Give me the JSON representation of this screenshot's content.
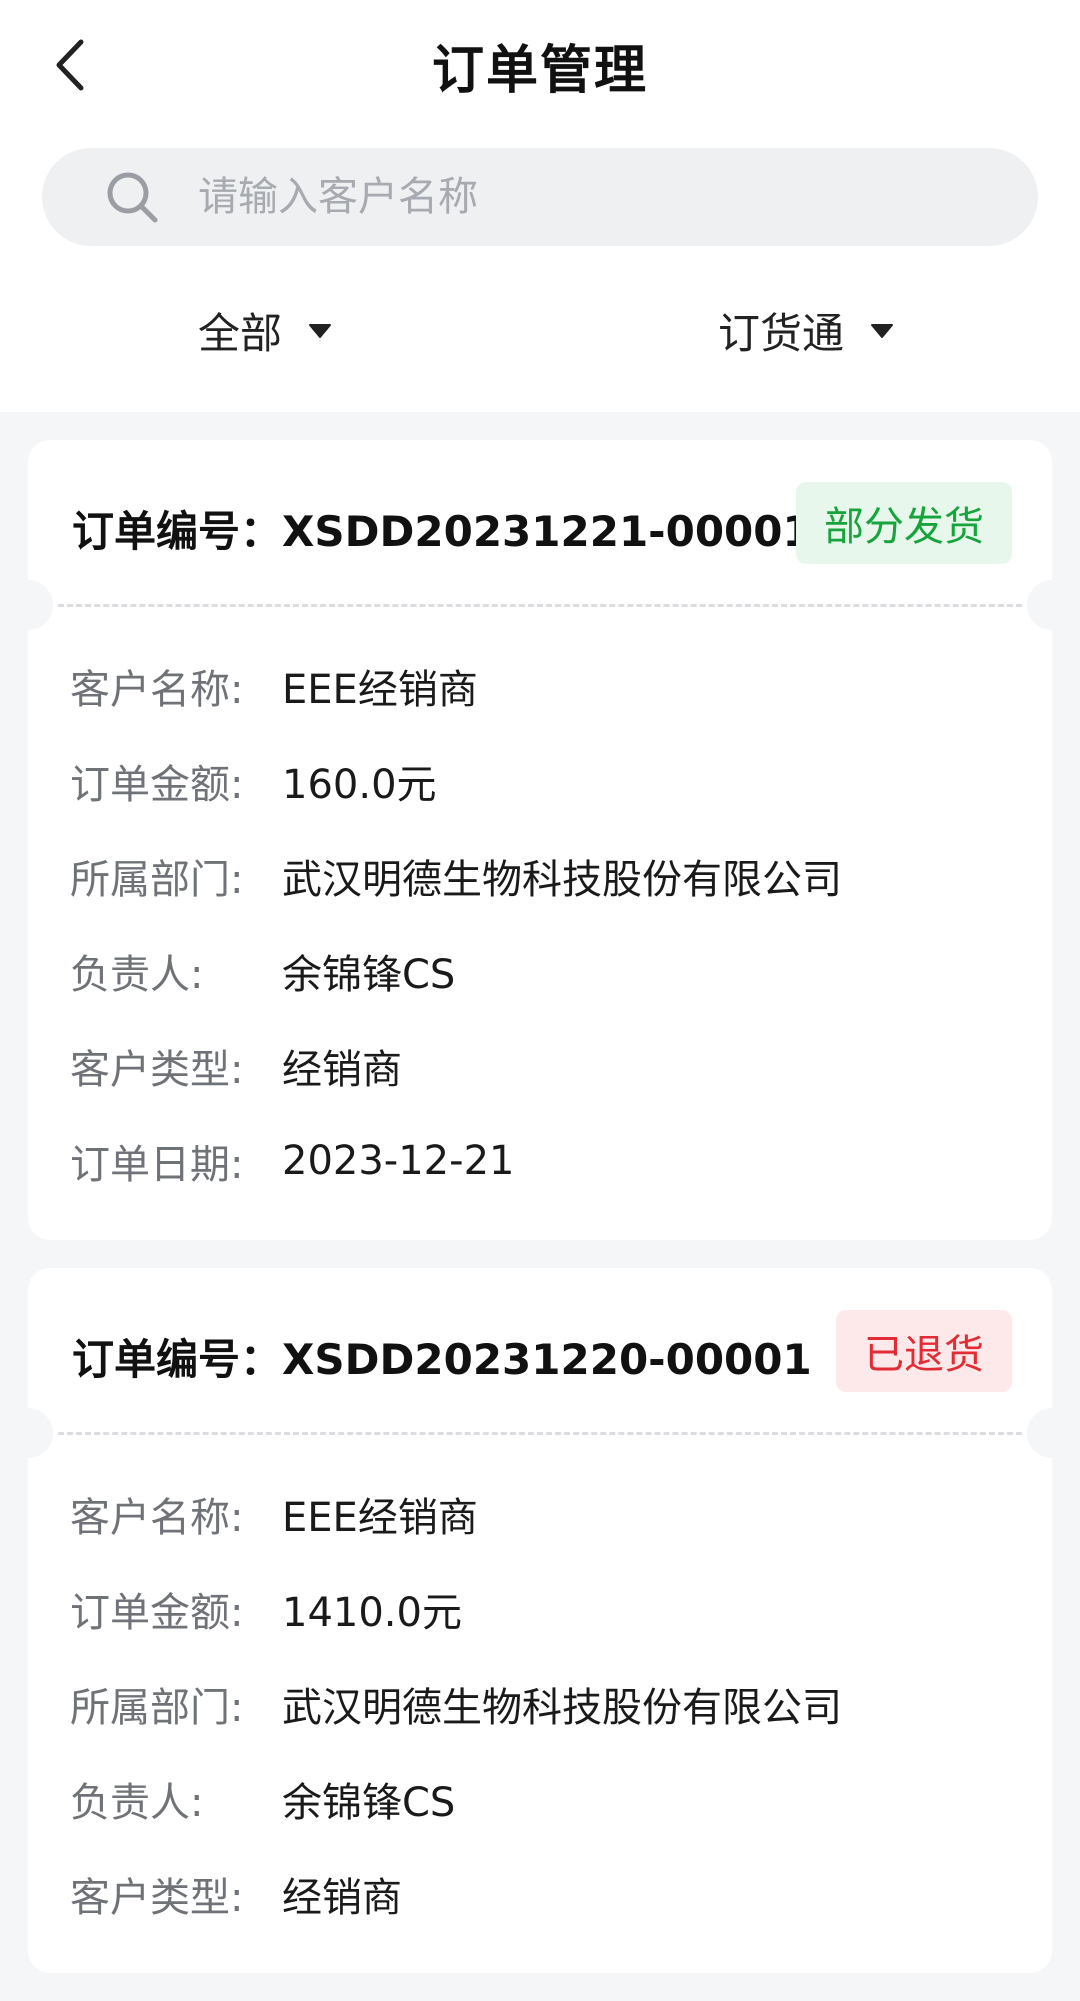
{
  "header": {
    "title": "订单管理",
    "back_icon": "chevron-left-icon"
  },
  "search": {
    "placeholder": "请输入客户名称",
    "value": ""
  },
  "filters": [
    {
      "label": "全部"
    },
    {
      "label": "订货通"
    }
  ],
  "labels": {
    "order_no": "订单编号：",
    "customer": "客户名称:",
    "amount": "订单金额:",
    "dept": "所属部门:",
    "owner": "负责人:",
    "cust_type": "客户类型:",
    "date": "订单日期:"
  },
  "orders": [
    {
      "order_no": "XSDD20231221-00001",
      "status": "部分发货",
      "status_color": "#17a43d",
      "customer": "EEE经销商",
      "amount": "160.0元",
      "dept": "武汉明德生物科技股份有限公司",
      "owner": "余锦锋CS",
      "cust_type": "经销商",
      "date": "2023-12-21"
    },
    {
      "order_no": "XSDD20231220-00001",
      "status": "已退货",
      "status_color": "#e22c35",
      "customer": "EEE经销商",
      "amount": "1410.0元",
      "dept": "武汉明德生物科技股份有限公司",
      "owner": "余锦锋CS",
      "cust_type": "经销商"
    }
  ]
}
